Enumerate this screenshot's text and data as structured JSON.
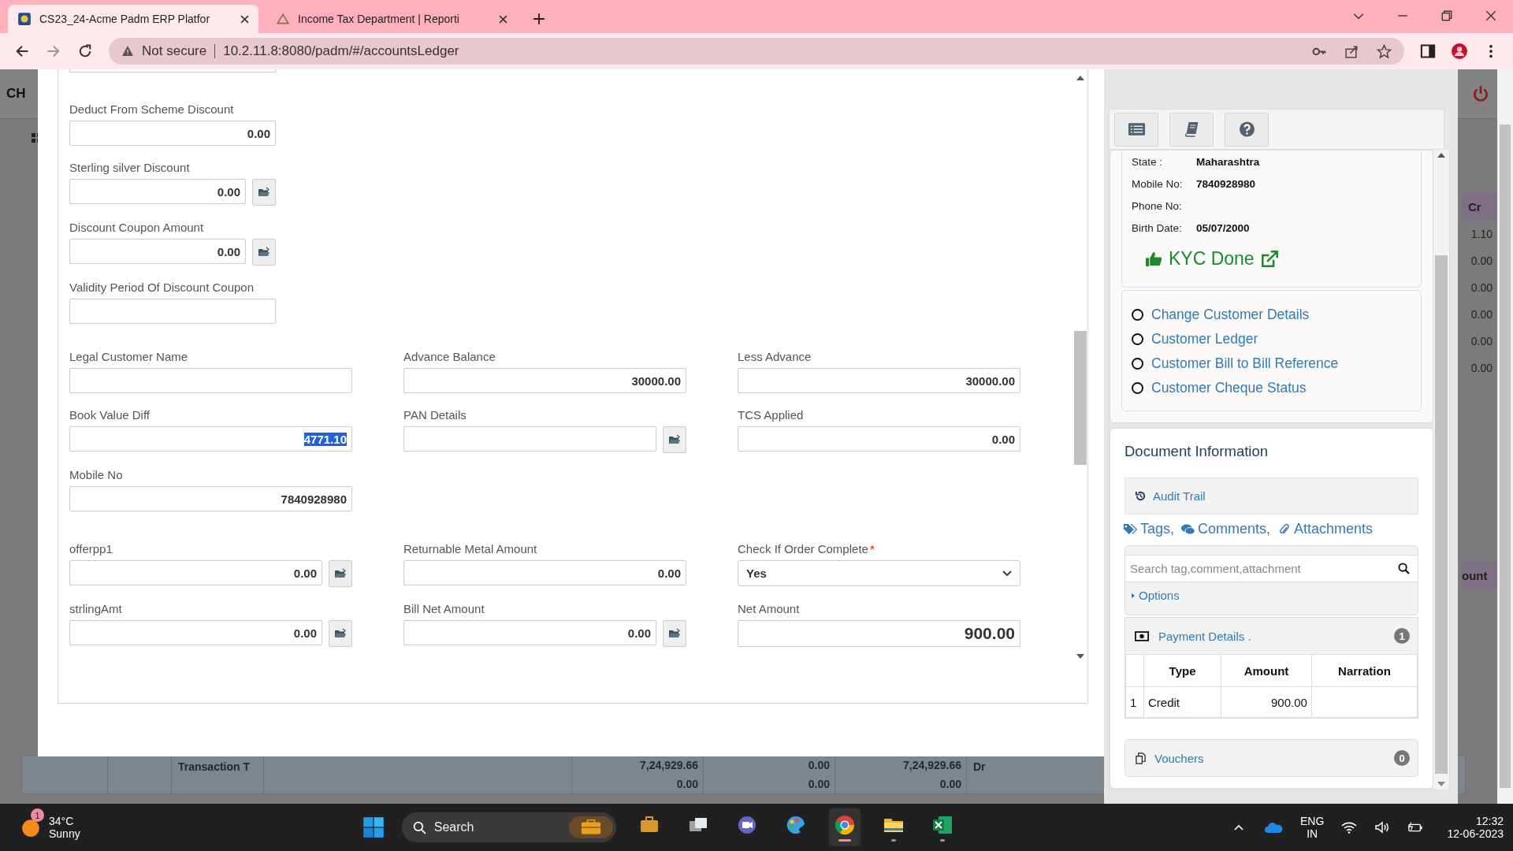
{
  "browser": {
    "tabs": [
      {
        "title": "CS23_24-Acme Padm ERP Platfor",
        "selected": true
      },
      {
        "title": "Income Tax Department | Reporti",
        "selected": false
      }
    ],
    "security_label": "Not secure",
    "url": "10.2.11.8:8080/padm/#/accountsLedger"
  },
  "background_app": {
    "header_text": "CH",
    "ledger_column": {
      "heading": "Cr",
      "cells": [
        "1.10",
        "0.00",
        "0.00",
        "0.00",
        "0.00",
        "0.00"
      ]
    },
    "lower_heading": "ount",
    "totals_row": {
      "label": "Transaction T",
      "cells": [
        [
          "7,24,929.66",
          "0.00"
        ],
        [
          "0.00",
          "0.00"
        ],
        [
          "7,24,929.66",
          "0.00"
        ]
      ],
      "side": "Dr"
    }
  },
  "form": {
    "top_fields": [
      {
        "label": "Deduct From Scheme Discount",
        "value": "0.00",
        "kind": "input"
      },
      {
        "label": "Sterling silver Discount",
        "value": "0.00",
        "lookup": true,
        "kind": "input"
      },
      {
        "label": "Discount Coupon Amount",
        "value": "0.00",
        "lookup": true,
        "kind": "input"
      },
      {
        "label": "Validity Period Of Discount Coupon",
        "kind": "input"
      }
    ],
    "rows": [
      [
        {
          "label": "Legal Customer Name",
          "kind": "input"
        },
        {
          "label": "Advance Balance",
          "value": "30000.00",
          "kind": "input"
        },
        {
          "label": "Less Advance",
          "value": "30000.00",
          "kind": "input"
        }
      ],
      [
        {
          "label": "Book Value Diff",
          "value": "4771.10",
          "kind": "input",
          "highlighted": true
        },
        {
          "label": "PAN Details",
          "lookup": true,
          "kind": "input"
        },
        {
          "label": "TCS Applied",
          "value": "0.00",
          "kind": "input"
        }
      ],
      [
        {
          "label": "Mobile No",
          "value": "7840928980",
          "kind": "input"
        }
      ],
      [
        {
          "label": "offerpp1",
          "value": "0.00",
          "lookup": true,
          "kind": "input"
        },
        {
          "label": "Returnable Metal Amount",
          "value": "0.00",
          "kind": "input"
        },
        {
          "label": "Check If Order Complete",
          "required_mark": "*",
          "value": "Yes",
          "kind": "select"
        }
      ],
      [
        {
          "label": "strlingAmt",
          "value": "0.00",
          "lookup": true,
          "kind": "input"
        },
        {
          "label": "Bill Net Amount",
          "value": "0.00",
          "lookup": true,
          "kind": "input"
        },
        {
          "label": "Net Amount",
          "value": "900.00",
          "kind": "total"
        }
      ]
    ]
  },
  "side_panel": {
    "customer": {
      "details": [
        {
          "label": "State :",
          "value": "Maharashtra"
        },
        {
          "label": "Mobile No:",
          "value": "7840928980"
        },
        {
          "label": "Phone No:"
        },
        {
          "label": "Birth Date:",
          "value": "05/07/2000"
        }
      ],
      "kyc_status": "KYC Done"
    },
    "links": [
      {
        "label": "Change Customer Details",
        "selected": false
      },
      {
        "label": "Customer Ledger",
        "selected": false
      },
      {
        "label": "Customer Bill to Bill Reference",
        "selected": false
      },
      {
        "label": "Customer Cheque Status",
        "selected": false
      }
    ],
    "document": {
      "heading": "Document Information",
      "audit_trail": "Audit Trail",
      "tags_links": [
        {
          "kind": "tags",
          "label": "Tags,"
        },
        {
          "kind": "comments",
          "label": "Comments,"
        },
        {
          "kind": "attachments",
          "label": "Attachments"
        }
      ],
      "search_placeholder": "Search tag,comment,attachment",
      "options": {
        "label": "Options",
        "expanded": false
      },
      "payment": {
        "title": "Payment Details .",
        "count": "1",
        "columns": [
          "Type",
          "Amount",
          "Narration"
        ],
        "rows": [
          {
            "index": "1",
            "type": "Credit",
            "amount": "900.00"
          }
        ]
      },
      "vouchers": {
        "title": "Vouchers",
        "count": "0"
      }
    }
  },
  "taskbar": {
    "weather": {
      "temperature": "34°C",
      "condition": "Sunny",
      "badge": "1"
    },
    "search_label": "Search",
    "apps": [
      {
        "kind": "briefcase",
        "open": false,
        "focused": false
      },
      {
        "kind": "taskview",
        "open": false,
        "focused": false
      },
      {
        "kind": "chat",
        "open": false,
        "focused": false
      },
      {
        "kind": "paint",
        "open": false,
        "focused": false
      },
      {
        "kind": "chrome",
        "open": true,
        "focused": true
      },
      {
        "kind": "folder",
        "open": true,
        "focused": false
      },
      {
        "kind": "excel",
        "open": true,
        "focused": false
      }
    ],
    "language": [
      "ENG",
      "IN"
    ],
    "time": "12:32",
    "date": "12-06-2023"
  }
}
